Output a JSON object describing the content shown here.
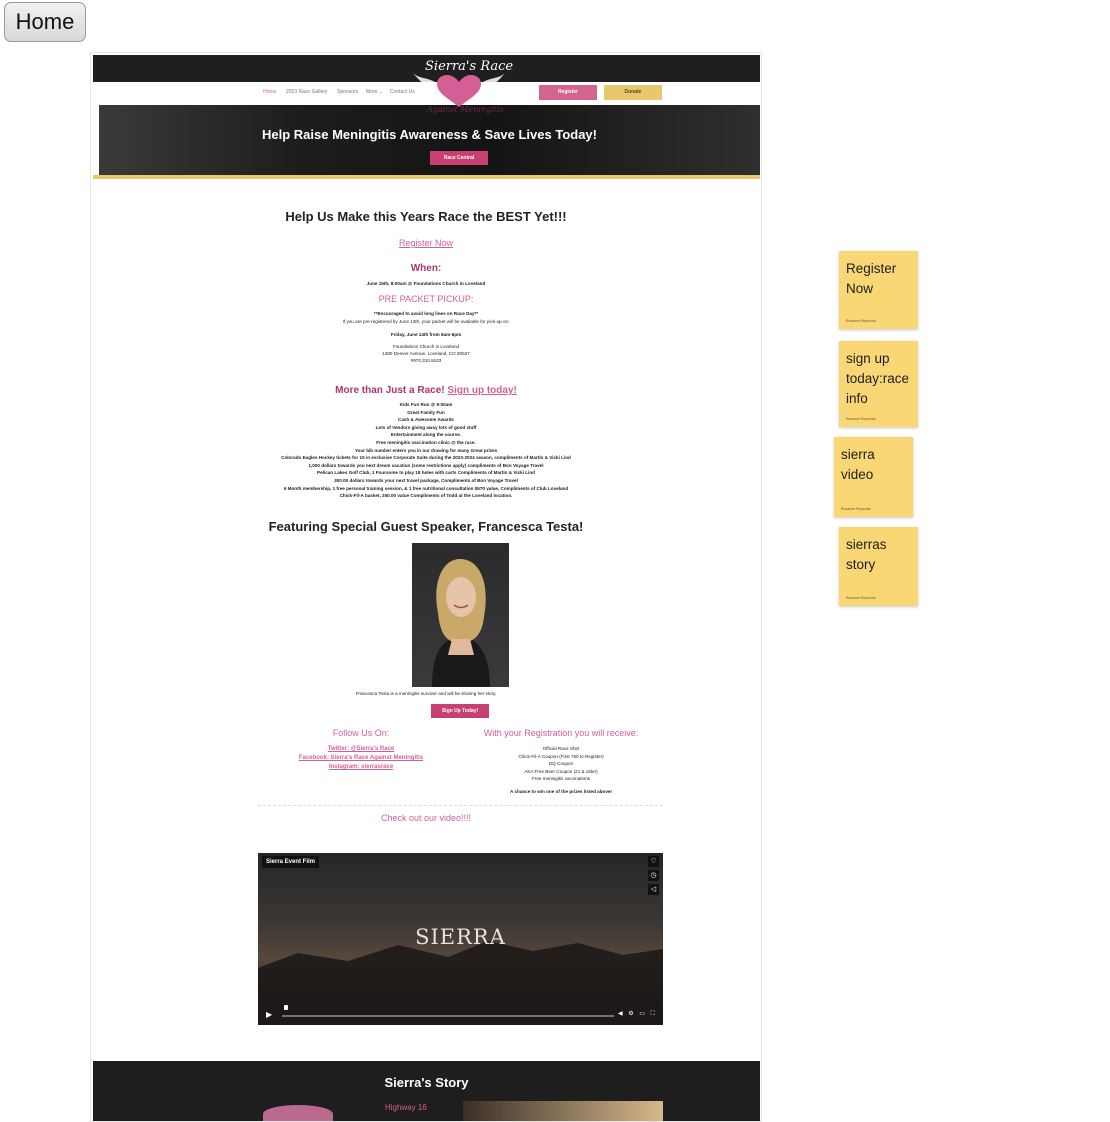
{
  "home_button": "Home",
  "site": {
    "nav": [
      "Home",
      "2023 Race Gallery",
      "Sponsors",
      "More ⌄",
      "Contact Us"
    ],
    "register_label": "Register",
    "donate_label": "Donate",
    "logo_line1": "Sierra's Race",
    "logo_line2": "Against Meningitis"
  },
  "hero": {
    "title": "Help Raise Meningitis Awareness & Save Lives Today!",
    "button": "Race Central"
  },
  "main": {
    "heading": "Help Us Make this Years Race the BEST Yet!!!",
    "register_link": "Register Now",
    "when_label": "When:",
    "when_date": "June 15th, 8:00am @ Foundations Church in Loveland",
    "prepacket_title": "PRE PACKET PICKUP:",
    "prepacket_note": "**Encouraged to avoid long lines on Race Day**",
    "prepacket_detail": "If you are pre-registered by June 13th, your packet will be available for pick-up on:",
    "prepacket_time": "Friday, June 14th from 8am-6pm",
    "address": [
      "Foundations Church in Loveland",
      "1380 Denver Avenue, Loveland, CO 80537",
      "#970.310.9103"
    ],
    "more_label": "More than Just a Race!",
    "more_link": "Sign up today!",
    "features": [
      "Kids Fun Run @ 9:00am",
      "Great Family Fun",
      "Cash & Awesome Awards",
      "Lots of Vendors giving away lots of good stuff",
      "Entertainment along the course.",
      "Free meningitis vaccination clinic @ the race.",
      "Your bib number enters you in our drawing for many Great prizes",
      "Colorado Eagles Hockey tickets for 15 in exclusive Corporate Suite during the 2023-2024 season, compliments of Martin & Vicki Lind",
      "1,000 dollars towards you next dream vacation (some restrictions apply) compliments of Bon Voyage Travel",
      "Pelican Lakes Golf Club, 1 Foursome to play 18 holes with carts Compliments of Martin & Vicki Lind",
      "300.00 dollars towards your next travel package, Compliments of Bon Voyage Travel",
      "6 Month membership, 1 free personal training session, & 1 free nutritional consultation $570 value, Compliments of Club Loveland",
      "Chick-Fil-A basket, 250.00 value Compliments of Todd at the Loveland location."
    ],
    "speaker_heading": "Featuring Special Guest Speaker, Francesca Testa!",
    "speaker_caption": "Francesca Testa is a meningitis survivor and will be sharing her story.",
    "signup_button": "Sign Up Today!",
    "follow_title": "Follow Us On:",
    "follow_links": [
      "Twitter: @Sierra's Race",
      "Facebook: Sierra's Race Against Meningitis",
      "Instagram: sierrasrace"
    ],
    "receive_title": "With your Registration you will receive:",
    "receive_items": [
      "Official Race Shirt",
      "Chick-Fil-A Coupon (First 750 to Register)",
      "DQ Coupon",
      "AKA Free Beer Coupon (21 & older)",
      "Free meningitis vaccinations"
    ],
    "receive_bold": "A chance to win one of the prizes listed above!",
    "video_link": "Check out our video!!!!",
    "video_title": "Sierra Event Film",
    "video_center": "SIERRA",
    "story_title": "Sierra's Story",
    "story_snippet": "Highway 16"
  },
  "notes": [
    {
      "text": "Register Now",
      "author": "Roxanne Reynolds"
    },
    {
      "text": "sign up today:race info",
      "author": "Roxanne Reynolds"
    },
    {
      "text": "sierra video",
      "author": "Roxanne Reynolds"
    },
    {
      "text": "sierras story",
      "author": "Roxanne Reynolds"
    }
  ],
  "colors": {
    "accent_pink": "#d45f96",
    "button_pink": "#c8406f",
    "gold": "#e8c76d",
    "note_yellow": "#f8d774"
  }
}
